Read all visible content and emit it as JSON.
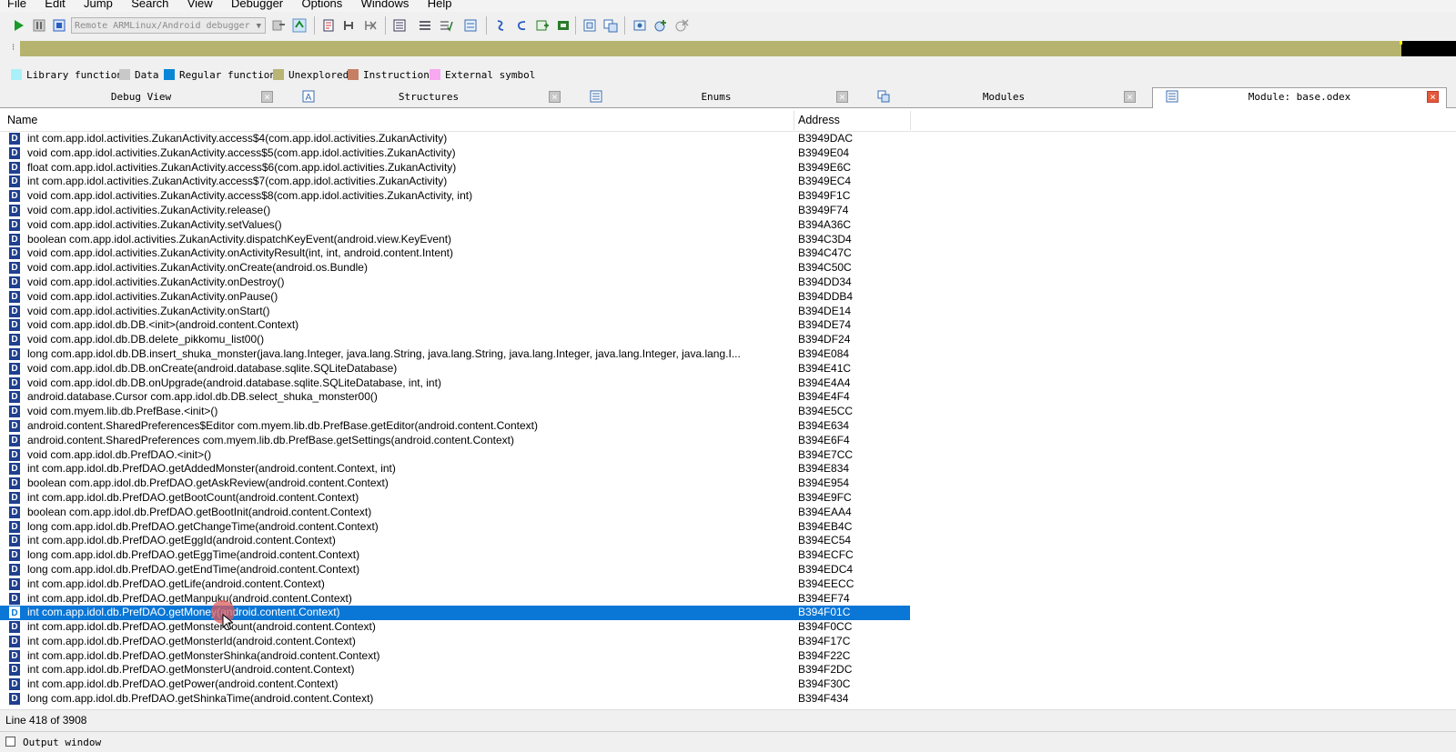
{
  "menu": [
    "File",
    "Edit",
    "Jump",
    "Search",
    "View",
    "Debugger",
    "Options",
    "Windows",
    "Help"
  ],
  "toolbar": {
    "debugger_select": "Remote ARMLinux/Android debugger",
    "icons": [
      "play-icon",
      "pause-icon",
      "stop-icon",
      "attach-icon",
      "detach-icon"
    ]
  },
  "legend": [
    {
      "label": "Library function",
      "color": "#aaf0f8"
    },
    {
      "label": "Data",
      "color": "#c8c8c8"
    },
    {
      "label": "Regular function",
      "color": "#0a86d6"
    },
    {
      "label": "Unexplored",
      "color": "#b8b575"
    },
    {
      "label": "Instruction",
      "color": "#c58064"
    },
    {
      "label": "External symbol",
      "color": "#f8a8f0"
    }
  ],
  "tabs": [
    "Debug View",
    "Structures",
    "Enums",
    "Modules",
    "Module: base.odex"
  ],
  "columns": {
    "name": "Name",
    "address": "Address"
  },
  "rows": [
    {
      "name": "int com.app.idol.activities.ZukanActivity.access$4(com.app.idol.activities.ZukanActivity)",
      "addr": "B3949DAC"
    },
    {
      "name": "void com.app.idol.activities.ZukanActivity.access$5(com.app.idol.activities.ZukanActivity)",
      "addr": "B3949E04"
    },
    {
      "name": "float com.app.idol.activities.ZukanActivity.access$6(com.app.idol.activities.ZukanActivity)",
      "addr": "B3949E6C"
    },
    {
      "name": "int com.app.idol.activities.ZukanActivity.access$7(com.app.idol.activities.ZukanActivity)",
      "addr": "B3949EC4"
    },
    {
      "name": "void com.app.idol.activities.ZukanActivity.access$8(com.app.idol.activities.ZukanActivity, int)",
      "addr": "B3949F1C"
    },
    {
      "name": "void com.app.idol.activities.ZukanActivity.release()",
      "addr": "B3949F74"
    },
    {
      "name": "void com.app.idol.activities.ZukanActivity.setValues()",
      "addr": "B394A36C"
    },
    {
      "name": "boolean com.app.idol.activities.ZukanActivity.dispatchKeyEvent(android.view.KeyEvent)",
      "addr": "B394C3D4"
    },
    {
      "name": "void com.app.idol.activities.ZukanActivity.onActivityResult(int, int, android.content.Intent)",
      "addr": "B394C47C"
    },
    {
      "name": "void com.app.idol.activities.ZukanActivity.onCreate(android.os.Bundle)",
      "addr": "B394C50C"
    },
    {
      "name": "void com.app.idol.activities.ZukanActivity.onDestroy()",
      "addr": "B394DD34"
    },
    {
      "name": "void com.app.idol.activities.ZukanActivity.onPause()",
      "addr": "B394DDB4"
    },
    {
      "name": "void com.app.idol.activities.ZukanActivity.onStart()",
      "addr": "B394DE14"
    },
    {
      "name": "void com.app.idol.db.DB.<init>(android.content.Context)",
      "addr": "B394DE74"
    },
    {
      "name": "void com.app.idol.db.DB.delete_pikkomu_list00()",
      "addr": "B394DF24"
    },
    {
      "name": "long com.app.idol.db.DB.insert_shuka_monster(java.lang.Integer, java.lang.String, java.lang.String, java.lang.Integer, java.lang.Integer, java.lang.I...",
      "addr": "B394E084"
    },
    {
      "name": "void com.app.idol.db.DB.onCreate(android.database.sqlite.SQLiteDatabase)",
      "addr": "B394E41C"
    },
    {
      "name": "void com.app.idol.db.DB.onUpgrade(android.database.sqlite.SQLiteDatabase, int, int)",
      "addr": "B394E4A4"
    },
    {
      "name": "android.database.Cursor com.app.idol.db.DB.select_shuka_monster00()",
      "addr": "B394E4F4"
    },
    {
      "name": "void com.myem.lib.db.PrefBase.<init>()",
      "addr": "B394E5CC"
    },
    {
      "name": "android.content.SharedPreferences$Editor com.myem.lib.db.PrefBase.getEditor(android.content.Context)",
      "addr": "B394E634"
    },
    {
      "name": "android.content.SharedPreferences com.myem.lib.db.PrefBase.getSettings(android.content.Context)",
      "addr": "B394E6F4"
    },
    {
      "name": "void com.app.idol.db.PrefDAO.<init>()",
      "addr": "B394E7CC"
    },
    {
      "name": "int com.app.idol.db.PrefDAO.getAddedMonster(android.content.Context, int)",
      "addr": "B394E834"
    },
    {
      "name": "boolean com.app.idol.db.PrefDAO.getAskReview(android.content.Context)",
      "addr": "B394E954"
    },
    {
      "name": "int com.app.idol.db.PrefDAO.getBootCount(android.content.Context)",
      "addr": "B394E9FC"
    },
    {
      "name": "boolean com.app.idol.db.PrefDAO.getBootInit(android.content.Context)",
      "addr": "B394EAA4"
    },
    {
      "name": "long com.app.idol.db.PrefDAO.getChangeTime(android.content.Context)",
      "addr": "B394EB4C"
    },
    {
      "name": "int com.app.idol.db.PrefDAO.getEggId(android.content.Context)",
      "addr": "B394EC54"
    },
    {
      "name": "long com.app.idol.db.PrefDAO.getEggTime(android.content.Context)",
      "addr": "B394ECFC"
    },
    {
      "name": "long com.app.idol.db.PrefDAO.getEndTime(android.content.Context)",
      "addr": "B394EDC4"
    },
    {
      "name": "int com.app.idol.db.PrefDAO.getLife(android.content.Context)",
      "addr": "B394EECC"
    },
    {
      "name": "int com.app.idol.db.PrefDAO.getManpuku(android.content.Context)",
      "addr": "B394EF74"
    },
    {
      "name": "int com.app.idol.db.PrefDAO.getMoney(android.content.Context)",
      "addr": "B394F01C",
      "selected": true
    },
    {
      "name": "int com.app.idol.db.PrefDAO.getMonsterCount(android.content.Context)",
      "addr": "B394F0CC"
    },
    {
      "name": "int com.app.idol.db.PrefDAO.getMonsterId(android.content.Context)",
      "addr": "B394F17C"
    },
    {
      "name": "int com.app.idol.db.PrefDAO.getMonsterShinka(android.content.Context)",
      "addr": "B394F22C"
    },
    {
      "name": "int com.app.idol.db.PrefDAO.getMonsterU(android.content.Context)",
      "addr": "B394F2DC"
    },
    {
      "name": "int com.app.idol.db.PrefDAO.getPower(android.content.Context)",
      "addr": "B394F30C"
    },
    {
      "name": "long com.app.idol.db.PrefDAO.getShinkaTime(android.content.Context)",
      "addr": "B394F434"
    }
  ],
  "row_badge": "D",
  "status": "Line 418 of 3908",
  "output_window": "Output window"
}
